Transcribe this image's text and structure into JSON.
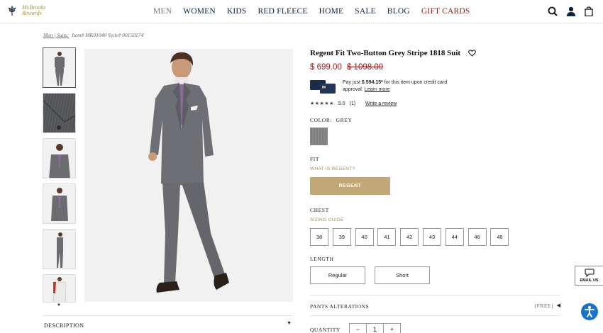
{
  "header": {
    "logo_line1": "Mr.Brooks",
    "logo_line2": "Rewards",
    "nav": [
      {
        "label": "MEN"
      },
      {
        "label": "WOMEN"
      },
      {
        "label": "KIDS"
      },
      {
        "label": "RED FLEECE"
      },
      {
        "label": "HOME"
      },
      {
        "label": "SALE"
      },
      {
        "label": "BLOG"
      },
      {
        "label": "GIFT CARDS"
      }
    ],
    "icons": [
      "search-icon",
      "account-icon",
      "bag-icon"
    ],
    "colors": {
      "nav": "#0c2340",
      "active": "#7a7a7a",
      "gift": "#8b1a1a",
      "gold": "#a88c4a"
    }
  },
  "breadcrumb": {
    "link": "Men | Suits:",
    "item": "Item# MK01040 Style# 00150174"
  },
  "product": {
    "title": "Regent Fit Two-Button Grey Stripe 1818 Suit",
    "price": "$ 699.00",
    "old_price": "$ 1098.00",
    "credit_prefix": "Pay just ",
    "credit_amount": "$ 594.15*",
    "credit_suffix": " for this item upon credit card approval. ",
    "credit_link": "Learn more",
    "stars": "★★★★★",
    "rating": "5.0",
    "review_count": "(1)",
    "write_review": "Write a review",
    "color_label": "COLOR:",
    "color_value": "GREY",
    "fit_label": "FIT",
    "fit_link": "WHAT IS REGENT?",
    "fit_button": "REGENT",
    "chest_label": "CHEST",
    "sizing_link": "SIZING GUIDE",
    "sizes": [
      "38",
      "39",
      "40",
      "41",
      "42",
      "43",
      "44",
      "46",
      "48"
    ],
    "length_label": "LENGTH",
    "lengths": [
      "Regular",
      "Short"
    ],
    "alterations_label": "PANTS ALTERATIONS",
    "alterations_value": "(FREE)",
    "quantity_label": "QUANTITY",
    "quantity_minus": "−",
    "quantity_value": "1",
    "quantity_plus": "+",
    "price_color": "#8b1a1a",
    "button_color": "#c3a877"
  },
  "gallery": {
    "thumb_count_visible": 6,
    "description_label": "DESCRIPTION"
  },
  "widgets": {
    "email_us": "EMAIL US"
  }
}
